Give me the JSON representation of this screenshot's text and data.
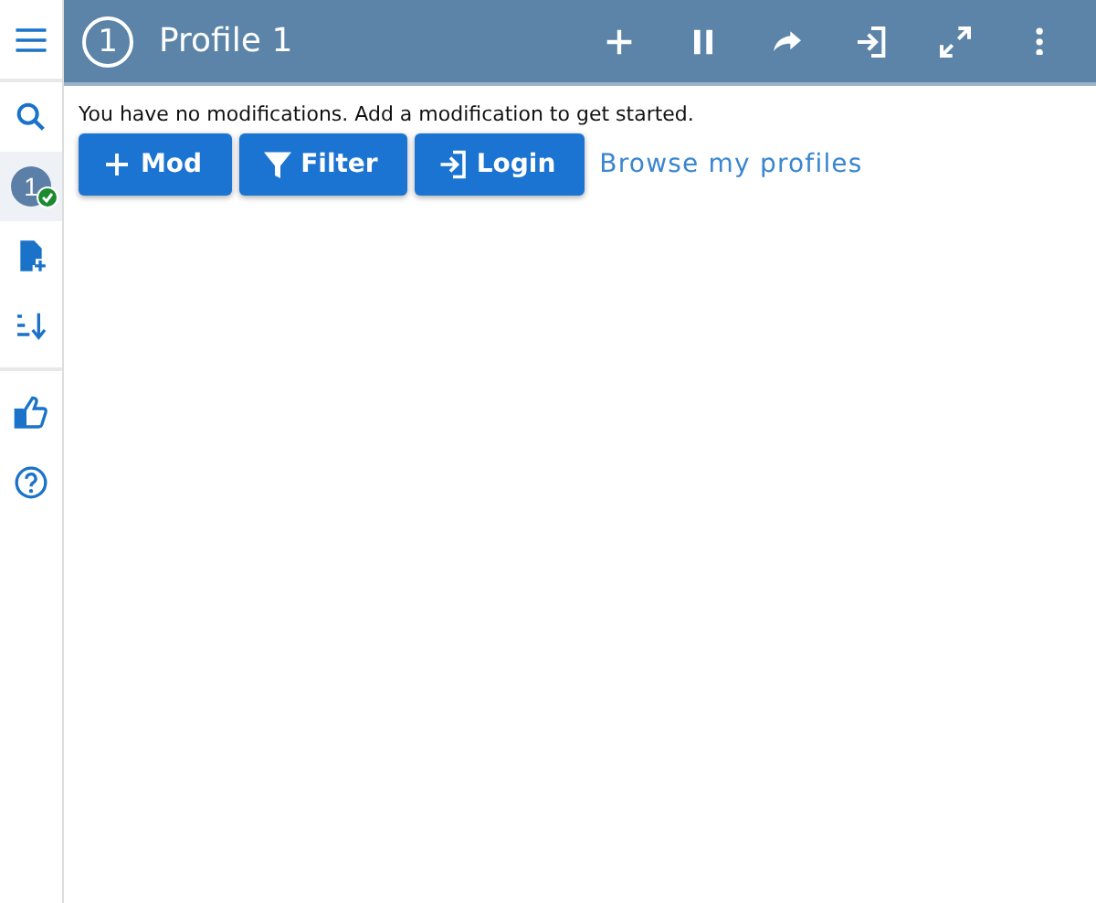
{
  "sidebar": {
    "items": [
      {
        "kind": "search",
        "selected": false
      },
      {
        "kind": "profile",
        "label": "1",
        "active": true,
        "selected": true
      },
      {
        "kind": "add-file",
        "selected": false
      },
      {
        "kind": "sort",
        "selected": false
      },
      {
        "kind": "like",
        "selected": false
      },
      {
        "kind": "help",
        "selected": false
      }
    ]
  },
  "header": {
    "number": "1",
    "title": "Profile 1",
    "actions": [
      {
        "kind": "add"
      },
      {
        "kind": "pause"
      },
      {
        "kind": "share"
      },
      {
        "kind": "login"
      },
      {
        "kind": "expand"
      },
      {
        "kind": "more"
      }
    ]
  },
  "message": "You have no modifications. Add a modification to get started.",
  "buttons": [
    {
      "kind": "add",
      "label": "Mod"
    },
    {
      "kind": "filter",
      "label": "Filter"
    },
    {
      "kind": "login",
      "label": "Login"
    }
  ],
  "link": "Browse my profiles"
}
